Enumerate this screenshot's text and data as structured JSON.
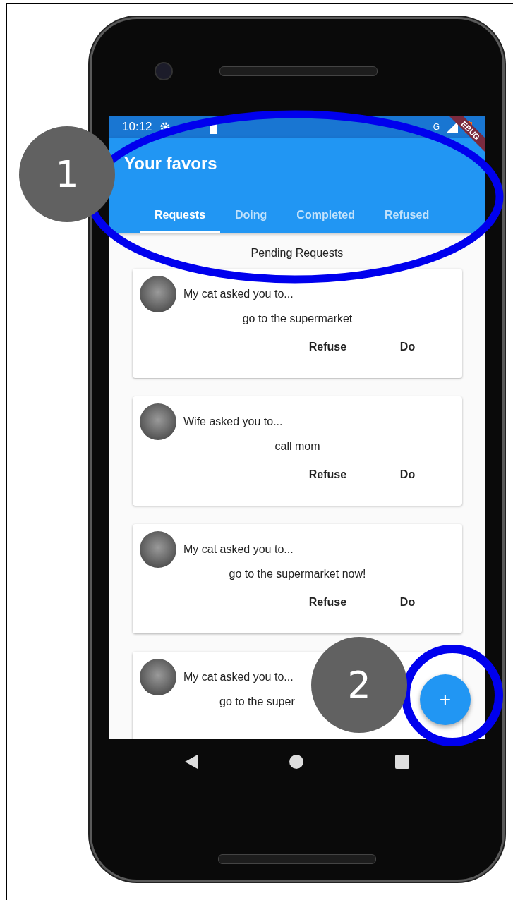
{
  "annotations": [
    {
      "label": "1"
    },
    {
      "label": "2"
    }
  ],
  "status_bar": {
    "time": "10:12",
    "network": "G"
  },
  "debug_banner": "EBUG",
  "app_bar": {
    "title": "Your favors"
  },
  "tabs": [
    {
      "label": "Requests",
      "selected": true
    },
    {
      "label": "Doing",
      "selected": false
    },
    {
      "label": "Completed",
      "selected": false
    },
    {
      "label": "Refused",
      "selected": false
    }
  ],
  "section_title": "Pending Requests",
  "requests": [
    {
      "asker": "My cat asked you to...",
      "task": "go to the supermarket",
      "actions": [
        "Refuse",
        "Do"
      ]
    },
    {
      "asker": "Wife asked you to...",
      "task": "call mom",
      "actions": [
        "Refuse",
        "Do"
      ]
    },
    {
      "asker": "My cat asked you to...",
      "task": "go to the supermarket now!",
      "actions": [
        "Refuse",
        "Do"
      ]
    },
    {
      "asker": "My cat asked you to...",
      "task": "go to the super",
      "covered": true
    }
  ],
  "fab": {
    "label": "+"
  }
}
